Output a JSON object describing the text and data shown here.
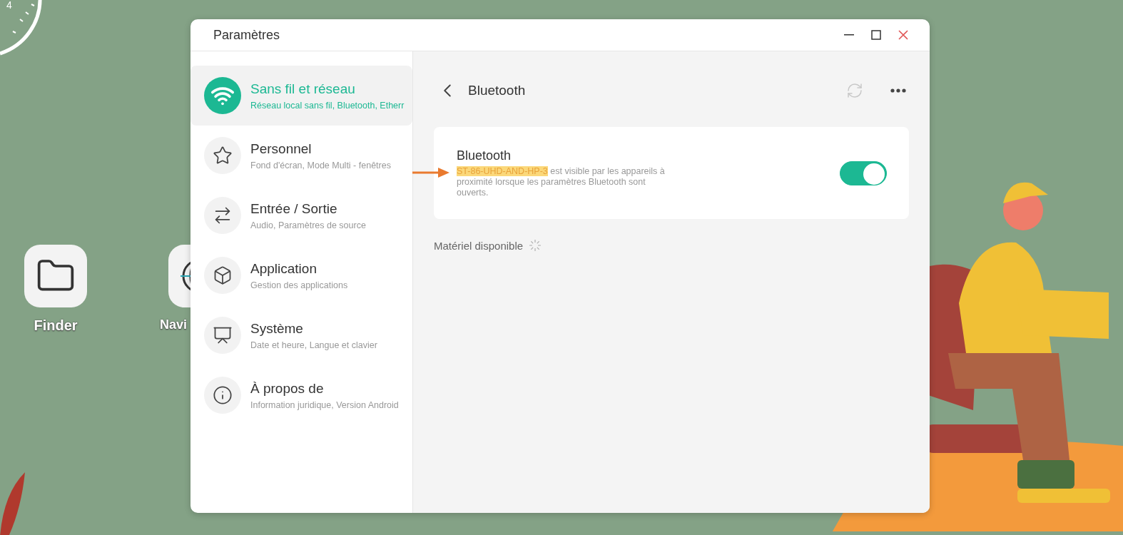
{
  "desktop": {
    "clock_numeral": "4",
    "apps": [
      {
        "label": "Finder",
        "kind": "folder"
      },
      {
        "label": "Navi",
        "kind": "globe"
      }
    ]
  },
  "window": {
    "title": "Paramètres"
  },
  "sidebar": {
    "items": [
      {
        "kind": "wifi",
        "title": "Sans fil et réseau",
        "subtitle": "Réseau local sans fil, Bluetooth, Etherr",
        "selected": true
      },
      {
        "kind": "star",
        "title": "Personnel",
        "subtitle": "Fond d'écran, Mode Multi - fenêtres",
        "selected": false
      },
      {
        "kind": "swap",
        "title": "Entrée / Sortie",
        "subtitle": "Audio, Paramètres de source",
        "selected": false
      },
      {
        "kind": "cube",
        "title": "Application",
        "subtitle": "Gestion des applications",
        "selected": false
      },
      {
        "kind": "screen",
        "title": "Système",
        "subtitle": "Date et heure, Langue et clavier",
        "selected": false
      },
      {
        "kind": "info",
        "title": "À propos de",
        "subtitle": "Information juridique, Version Android",
        "selected": false
      }
    ]
  },
  "page": {
    "title": "Bluetooth"
  },
  "bluetooth": {
    "label": "Bluetooth",
    "device_name": "ST-86-UHD-AND-HP-3",
    "description": "est visible par les appareils à proximité lorsque les paramètres Bluetooth sont ouverts.",
    "on": true
  },
  "available": {
    "label": "Matériel disponible"
  }
}
